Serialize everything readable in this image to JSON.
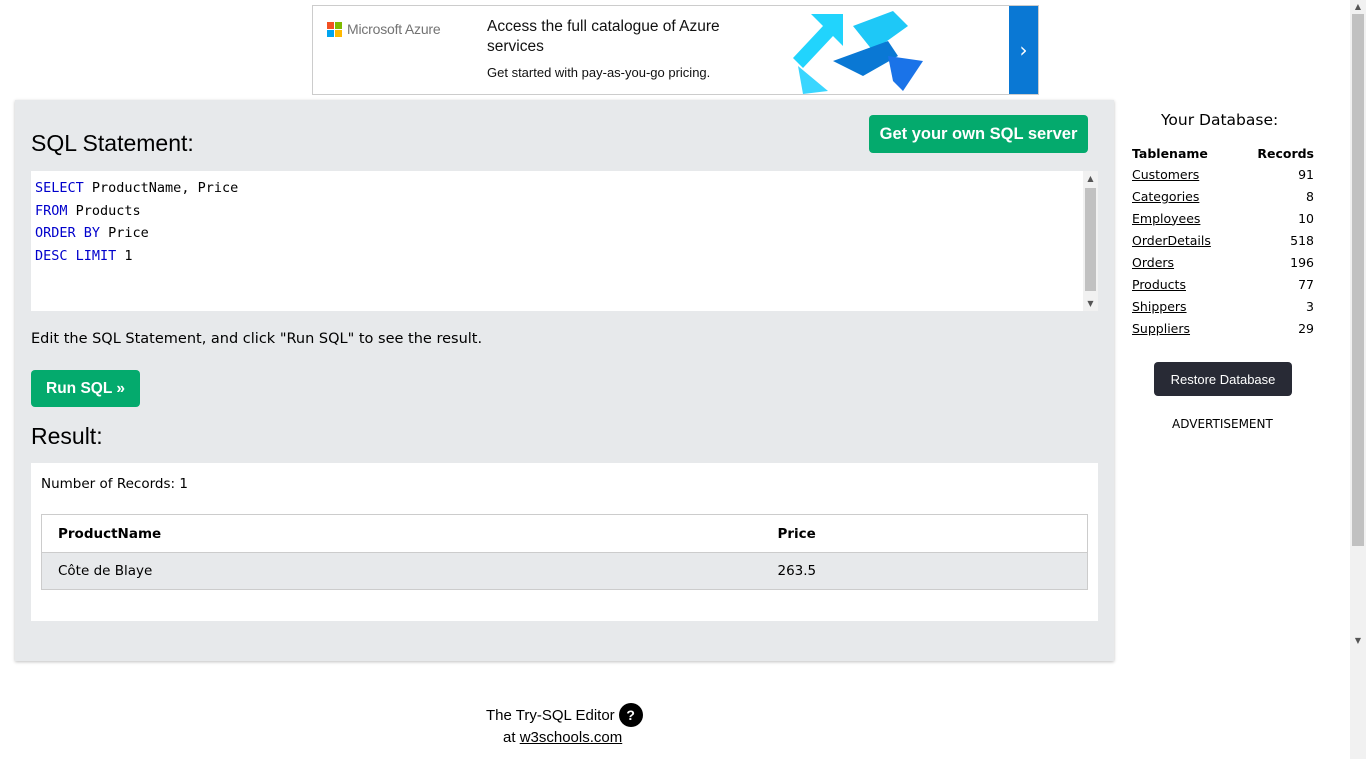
{
  "ad": {
    "brand": "Microsoft Azure",
    "headline": "Access the full catalogue of Azure services",
    "subline": "Get started with pay-as-you-go pricing.",
    "next_glyph": "›",
    "info_glyph": "ⓘ",
    "close_glyph": "✕",
    "colors": {
      "red": "#f25022",
      "green": "#7fba00",
      "blue": "#00a4ef",
      "yellow": "#ffb900"
    }
  },
  "editor": {
    "heading": "SQL Statement:",
    "own_server_button": "Get your own SQL server",
    "code_lines": [
      {
        "kw": "SELECT",
        "rest": " ProductName, Price"
      },
      {
        "kw": "FROM",
        "rest": " Products"
      },
      {
        "kw": "ORDER BY",
        "rest": " Price"
      },
      {
        "kw": "DESC LIMIT",
        "rest": " 1"
      }
    ],
    "hint": "Edit the SQL Statement, and click \"Run SQL\" to see the result.",
    "run_button": "Run SQL »"
  },
  "result": {
    "heading": "Result:",
    "record_count": "Number of Records: 1",
    "columns": [
      "ProductName",
      "Price"
    ],
    "rows": [
      [
        "Côte de Blaye",
        "263.5"
      ]
    ]
  },
  "sidebar": {
    "title": "Your Database:",
    "col_table": "Tablename",
    "col_records": "Records",
    "tables": [
      {
        "name": "Customers",
        "records": "91"
      },
      {
        "name": "Categories",
        "records": "8"
      },
      {
        "name": "Employees",
        "records": "10"
      },
      {
        "name": "OrderDetails",
        "records": "518"
      },
      {
        "name": "Orders",
        "records": "196"
      },
      {
        "name": "Products",
        "records": "77"
      },
      {
        "name": "Shippers",
        "records": "3"
      },
      {
        "name": "Suppliers",
        "records": "29"
      }
    ],
    "restore_button": "Restore Database",
    "advertisement_label": "ADVERTISEMENT"
  },
  "footer": {
    "line1": "The Try-SQL Editor",
    "help_glyph": "?",
    "at": "at ",
    "link": "w3schools.com"
  },
  "colors": {
    "accent_green": "#04aa6d",
    "panel_bg": "#e7e9eb",
    "dark_button": "#282a35",
    "keyword_blue": "#0000cc"
  }
}
